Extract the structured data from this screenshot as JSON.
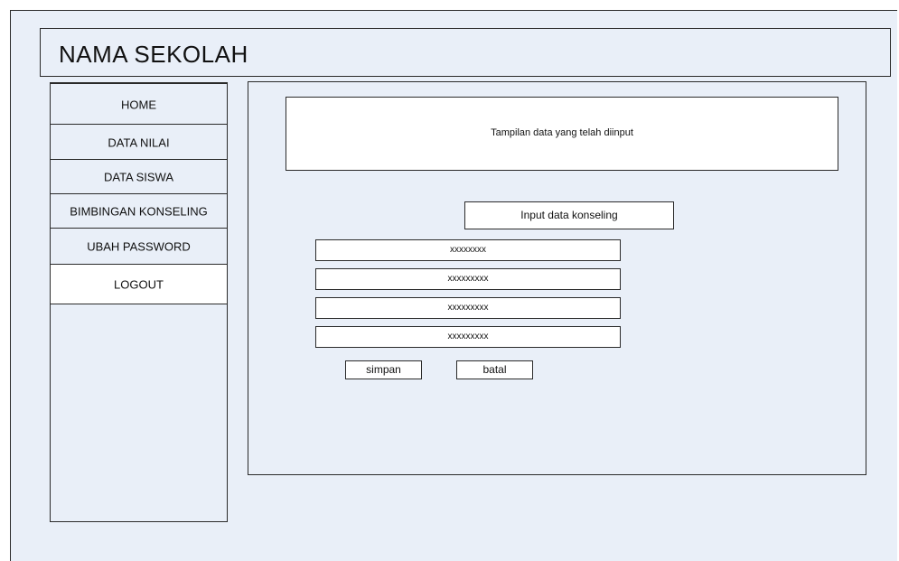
{
  "header": {
    "title": "NAMA SEKOLAH"
  },
  "sidebar": {
    "items": [
      {
        "label": "HOME"
      },
      {
        "label": "DATA NILAI"
      },
      {
        "label": "DATA SISWA"
      },
      {
        "label": "BIMBINGAN KONSELING"
      },
      {
        "label": "UBAH PASSWORD"
      },
      {
        "label": "LOGOUT"
      }
    ]
  },
  "main": {
    "display_text": "Tampilan data yang telah diinput",
    "form_title": "Input data konseling",
    "fields": [
      {
        "value": "xxxxxxxx"
      },
      {
        "value": "xxxxxxxxx"
      },
      {
        "value": "xxxxxxxxx"
      },
      {
        "value": "xxxxxxxxx"
      }
    ],
    "save_label": "simpan",
    "cancel_label": "batal"
  }
}
